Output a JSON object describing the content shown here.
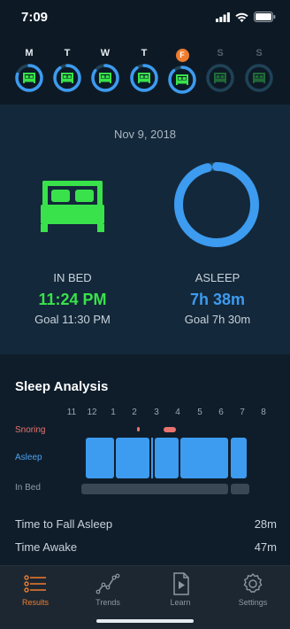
{
  "status": {
    "time": "7:09"
  },
  "week": {
    "days": [
      {
        "letter": "M",
        "state": "done",
        "progress": 0.8
      },
      {
        "letter": "T",
        "state": "done",
        "progress": 0.9
      },
      {
        "letter": "W",
        "state": "done",
        "progress": 0.85
      },
      {
        "letter": "T",
        "state": "done",
        "progress": 0.9
      },
      {
        "letter": "F",
        "state": "today",
        "progress": 0.88
      },
      {
        "letter": "S",
        "state": "future",
        "progress": 0
      },
      {
        "letter": "S",
        "state": "future",
        "progress": 0
      }
    ]
  },
  "summary": {
    "date": "Nov 9, 2018",
    "in_bed": {
      "label": "IN BED",
      "value": "11:24 PM",
      "goal": "Goal 11:30 PM"
    },
    "asleep": {
      "label": "ASLEEP",
      "value": "7h 38m",
      "goal": "Goal 7h 30m",
      "progress": 0.96
    }
  },
  "analysis": {
    "title": "Sleep Analysis",
    "hours": [
      "11",
      "12",
      "1",
      "2",
      "3",
      "4",
      "5",
      "6",
      "7",
      "8"
    ],
    "rows": {
      "snoring": "Snoring",
      "asleep": "Asleep",
      "in_bed": "In Bed"
    },
    "metrics": [
      {
        "label": "Time to Fall Asleep",
        "value": "28m"
      },
      {
        "label": "Time Awake",
        "value": "47m"
      }
    ]
  },
  "tabs": [
    {
      "label": "Results",
      "icon": "results-list-icon",
      "active": true
    },
    {
      "label": "Trends",
      "icon": "trends-line-icon",
      "active": false
    },
    {
      "label": "Learn",
      "icon": "learn-doc-icon",
      "active": false
    },
    {
      "label": "Settings",
      "icon": "settings-gear-icon",
      "active": false
    }
  ],
  "colors": {
    "accent": "#f07c2e",
    "green": "#39e24b",
    "blue": "#3d9bf0",
    "snoring": "#e8736f",
    "ring_track": "#1f4257"
  }
}
